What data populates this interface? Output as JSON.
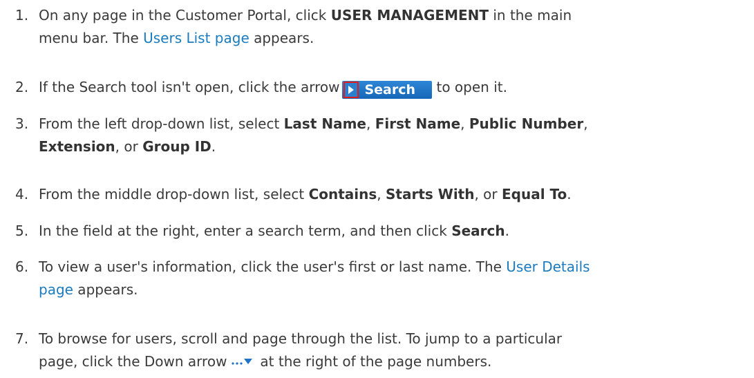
{
  "steps": [
    {
      "number": "1.",
      "parts": [
        "On any page in the Customer Portal, click ",
        "USER MANAGEMENT",
        " in the main",
        "menu bar. The ",
        "Users List page",
        " appears."
      ]
    },
    {
      "number": "2.",
      "parts": [
        "If the Search tool isn't open, click the arrow",
        "Search",
        "to open it."
      ]
    },
    {
      "number": "3.",
      "parts": [
        "From the left drop-down list, select ",
        "Last Name",
        ", ",
        "First Name",
        ", ",
        "Public Number",
        ",",
        "Extension",
        ", or ",
        "Group ID",
        "."
      ]
    },
    {
      "number": "4.",
      "parts": [
        "From the middle drop-down list, select ",
        "Contains",
        ", ",
        "Starts With",
        ", or ",
        "Equal To",
        "."
      ]
    },
    {
      "number": "5.",
      "parts": [
        "In the field at the right, enter a search term, and then click ",
        "Search",
        "."
      ]
    },
    {
      "number": "6.",
      "parts": [
        "To view a user's information, click the user's first or last name. The ",
        "User Details",
        "page",
        " appears."
      ]
    },
    {
      "number": "7.",
      "parts": [
        "To browse for users, scroll and page through the list. To jump to a particular",
        "page, click the Down arrow",
        "at the right of the page numbers."
      ]
    }
  ],
  "colors": {
    "text": "#3a3a3a",
    "link": "#1a7bbf",
    "search_button": "#1f73c4",
    "highlight_box": "#e21b1b",
    "arrow_icon": "#1f73c4"
  },
  "icons": {
    "search_arrow": "play-arrow-icon",
    "more": "ellipsis-icon",
    "down": "triangle-down-icon"
  }
}
